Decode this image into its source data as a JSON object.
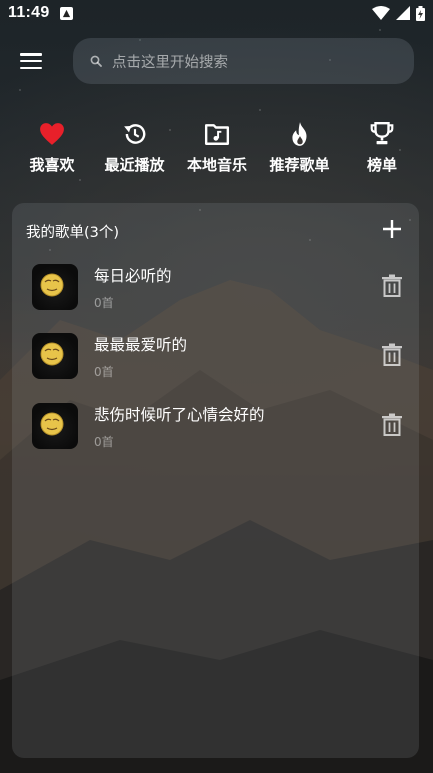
{
  "status_bar": {
    "time": "11:49"
  },
  "search": {
    "placeholder": "点击这里开始搜索"
  },
  "quick_nav": [
    {
      "label": "我喜欢",
      "icon": "heart-icon"
    },
    {
      "label": "最近播放",
      "icon": "history-icon"
    },
    {
      "label": "本地音乐",
      "icon": "folder-music-icon"
    },
    {
      "label": "推荐歌单",
      "icon": "fire-icon"
    },
    {
      "label": "榜单",
      "icon": "trophy-icon"
    }
  ],
  "playlists": {
    "title": "我的歌单(3个)",
    "items": [
      {
        "name": "每日必听的",
        "count": "0首"
      },
      {
        "name": "最最最爱听的",
        "count": "0首"
      },
      {
        "name": "悲伤时候听了心情会好的",
        "count": "0首"
      }
    ]
  },
  "colors": {
    "heart": "#e8202a",
    "panel": "rgba(150,155,160,0.18)"
  }
}
